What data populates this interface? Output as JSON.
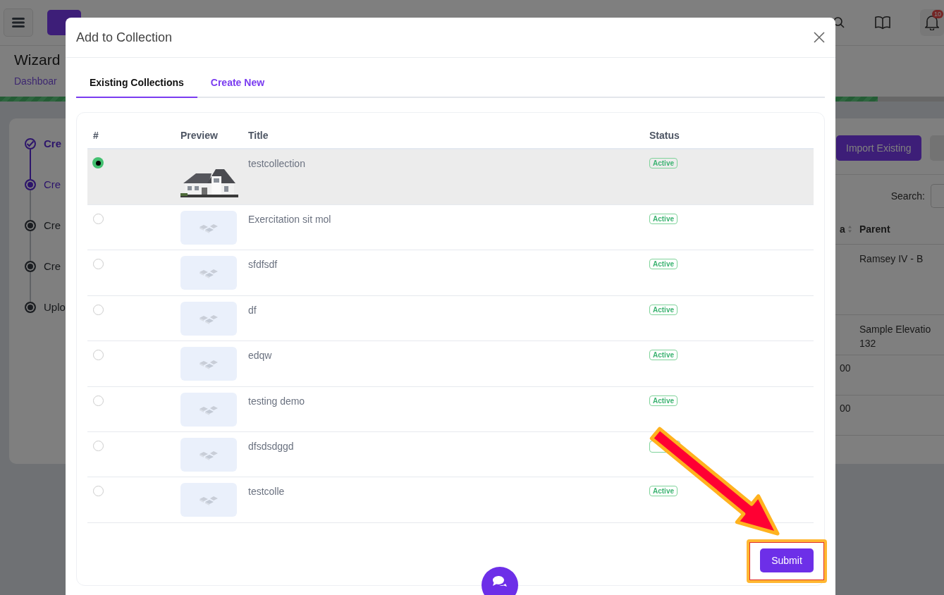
{
  "topbar": {
    "notification_count": "10"
  },
  "page": {
    "title": "Wizard",
    "breadcrumb": "Dashboar"
  },
  "progress": {
    "level": 0.93
  },
  "steps": [
    {
      "label": "Cre",
      "kind": "done"
    },
    {
      "label": "Cre",
      "kind": "current"
    },
    {
      "label": "Cre",
      "kind": "pending"
    },
    {
      "label": "Cre",
      "kind": "pending"
    },
    {
      "label": "Uplo",
      "kind": "pending"
    }
  ],
  "background_panel": {
    "button": "Import Existing",
    "search_label": "Search:",
    "columns": [
      "a",
      "Parent"
    ],
    "rows": [
      {
        "parent": [
          "Ramsey IV - B"
        ]
      },
      {
        "parent": [
          "Sample Elevatio",
          "132"
        ]
      },
      {
        "column_1": "00"
      },
      {
        "column_1": "00"
      }
    ]
  },
  "modal": {
    "title": "Add to Collection",
    "tabs": [
      {
        "label": "Existing Collections",
        "selected": true
      },
      {
        "label": "Create New",
        "selected": false
      }
    ],
    "columns": [
      "#",
      "Preview",
      "Title",
      "Status"
    ],
    "rows": [
      {
        "title": "testcollection",
        "status": "Active",
        "selected": true
      },
      {
        "kind": "placeholder",
        "title": "Exercitation sit mol",
        "status": "Active",
        "selected": false
      },
      {
        "kind": "placeholder",
        "title": "sfdfsdf",
        "status": "Active",
        "selected": false
      },
      {
        "kind": "placeholder",
        "title": "df",
        "status": "Active",
        "selected": false
      },
      {
        "kind": "placeholder",
        "title": "edqw",
        "status": "Active",
        "selected": false
      },
      {
        "kind": "placeholder",
        "title": "testing demo",
        "status": "Active",
        "selected": false
      },
      {
        "kind": "placeholder",
        "title": "dfsdsdggd",
        "selected": false
      },
      {
        "kind": "placeholder",
        "title": "testcolle",
        "status": "Active",
        "selected": false
      }
    ],
    "submit": "Submit"
  }
}
